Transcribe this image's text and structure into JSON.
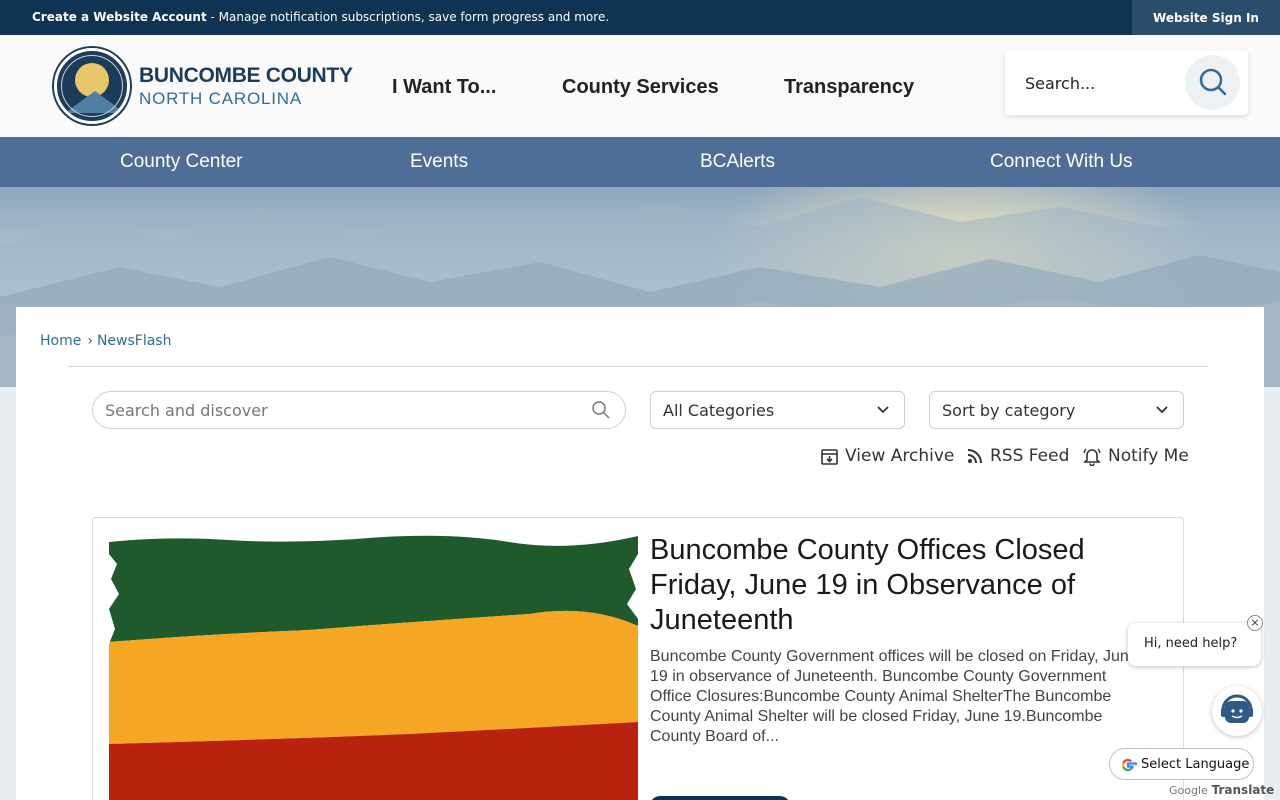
{
  "topbar": {
    "account_link": "Create a Website Account",
    "account_desc": " - Manage notification subscriptions, save form progress and more.",
    "signin_label": "Website Sign In"
  },
  "header": {
    "brand_line1": "BUNCOMBE COUNTY",
    "brand_line2": "NORTH CAROLINA",
    "nav": [
      "I Want To...",
      "County Services",
      "Transparency"
    ],
    "search_placeholder": "Search..."
  },
  "subnav": [
    "County Center",
    "Events",
    "BCAlerts",
    "Connect With Us"
  ],
  "breadcrumb": {
    "home": "Home",
    "separator": "›",
    "current": "NewsFlash"
  },
  "filters": {
    "search_placeholder": "Search and discover",
    "category": "All Categories",
    "sort": "Sort by category"
  },
  "actions": {
    "archive": "View Archive",
    "rss": "RSS Feed",
    "notify": "Notify Me"
  },
  "article": {
    "title": "Buncombe County Offices Closed Friday, June 19 in Observance of Juneteenth",
    "summary": "Buncombe County Government offices will be closed on Friday, June 19 in observance of Juneteenth.  Buncombe County Government Office Closures:Buncombe County Animal ShelterThe Buncombe County Animal Shelter will be closed Friday, June 19.Buncombe County Board of..."
  },
  "help": {
    "text": "Hi, need help?",
    "close": "×"
  },
  "translate": {
    "label": "Select Language",
    "powered_prefix": "Google",
    "powered_suffix": "Translate"
  },
  "colors": {
    "topbar": "#0f3352",
    "subnav": "#4f6e97",
    "link": "#2f6e9b",
    "flag_green": "#1f5a2c",
    "flag_gold": "#f5a623",
    "flag_red": "#b8220e"
  }
}
